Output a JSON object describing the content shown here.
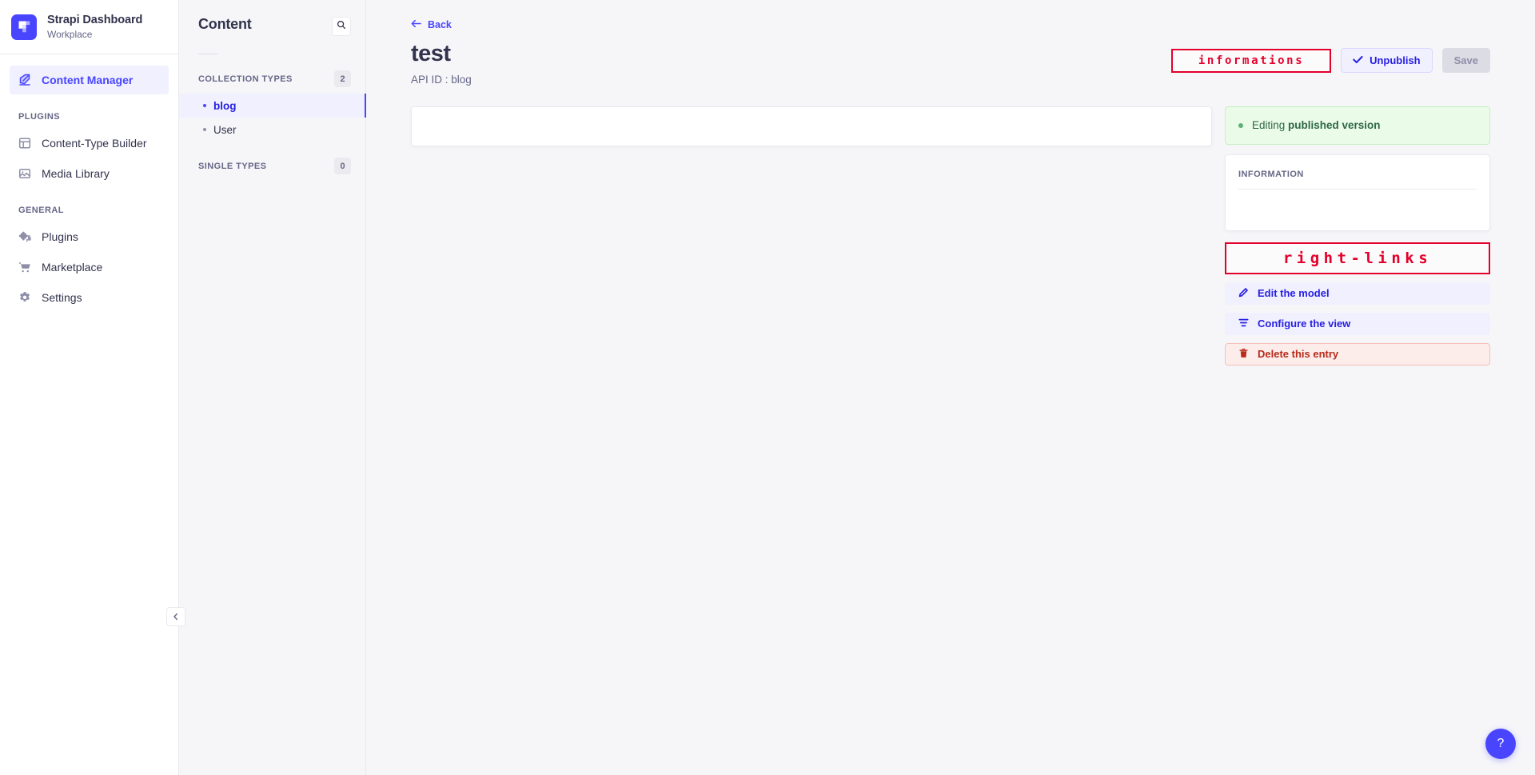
{
  "brand": {
    "title": "Strapi Dashboard",
    "subtitle": "Workplace",
    "logo_icon": "strapi-logo-icon",
    "accent_color": "#4945ff"
  },
  "sidebar": {
    "main_items": [
      {
        "label": "Content Manager",
        "icon": "feather-pen-icon",
        "active": true
      }
    ],
    "groups": [
      {
        "label": "PLUGINS",
        "items": [
          {
            "label": "Content-Type Builder",
            "icon": "layout-grid-icon"
          },
          {
            "label": "Media Library",
            "icon": "image-icon"
          }
        ]
      },
      {
        "label": "GENERAL",
        "items": [
          {
            "label": "Plugins",
            "icon": "puzzle-piece-icon"
          },
          {
            "label": "Marketplace",
            "icon": "shopping-cart-icon"
          },
          {
            "label": "Settings",
            "icon": "gear-icon"
          }
        ]
      }
    ],
    "collapse_icon": "chevron-left-icon"
  },
  "content_panel": {
    "title": "Content",
    "search_icon": "search-icon",
    "sections": [
      {
        "label": "COLLECTION TYPES",
        "count": "2",
        "items": [
          {
            "label": "blog",
            "selected": true
          },
          {
            "label": "User",
            "selected": false
          }
        ]
      },
      {
        "label": "SINGLE TYPES",
        "count": "0",
        "items": []
      }
    ]
  },
  "main": {
    "back_label": "Back",
    "back_icon": "arrow-left-icon",
    "title": "test",
    "subtitle": "API ID : blog",
    "actions": {
      "unpublish_label": "Unpublish",
      "unpublish_icon": "check-icon",
      "save_label": "Save"
    }
  },
  "annotations": {
    "informations": "informations",
    "right_links": "right-links",
    "color": "#e4002b"
  },
  "right_panel": {
    "status": {
      "prefix": "Editing ",
      "emphasis": "published version",
      "dot_color": "#5cb176"
    },
    "information_label": "INFORMATION",
    "links": [
      {
        "label": "Edit the model",
        "icon": "pencil-icon",
        "style": "purple"
      },
      {
        "label": "Configure the view",
        "icon": "sliders-icon",
        "style": "purple"
      },
      {
        "label": "Delete this entry",
        "icon": "trash-icon",
        "style": "danger"
      }
    ]
  },
  "help": {
    "label": "?",
    "icon": "question-mark-icon"
  }
}
